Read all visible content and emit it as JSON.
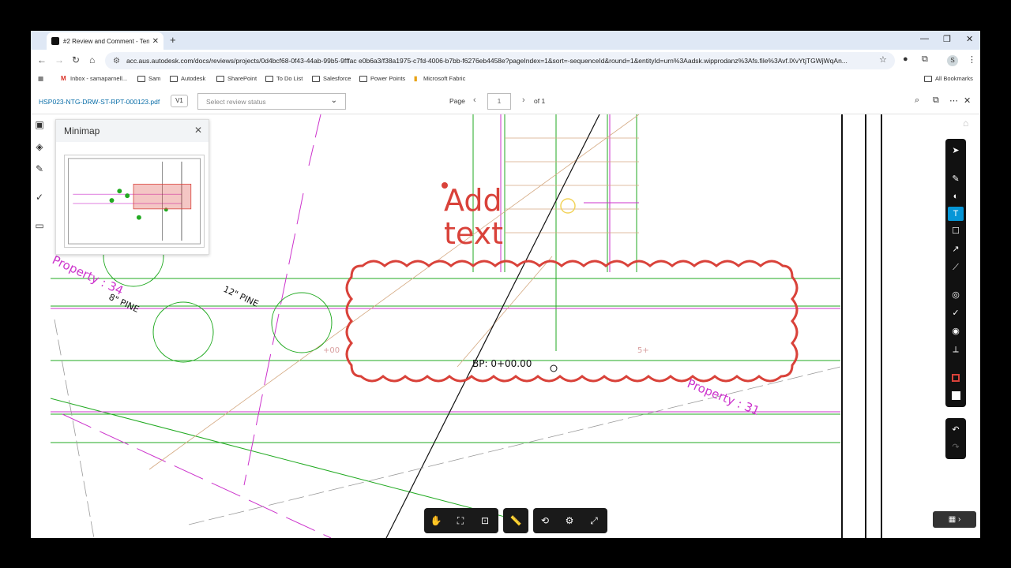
{
  "browser": {
    "tab_title": "#2 Review and Comment - Terr",
    "tab_close": "✕",
    "new_tab": "+",
    "url": "acc.aus.autodesk.com/docs/reviews/projects/0d4bcf68-0f43-44ab-99b5-9fffac e0b6a3/f38a1975-c7fd-4006-b7bb-f6276eb4458e?pageIndex=1&sort=-sequenceId&round=1&entityId=urn%3Aadsk.wipprodanz%3Afs.file%3Avf.lXvYtjTGWjWqAn...",
    "profile_initial": "S",
    "window_controls": {
      "minimize": "—",
      "restore": "❐",
      "close": "✕"
    }
  },
  "bookmarks": {
    "items": [
      {
        "label": "Inbox - samaparnell..."
      },
      {
        "label": "Sam"
      },
      {
        "label": "Autodesk"
      },
      {
        "label": "SharePoint"
      },
      {
        "label": "To Do List"
      },
      {
        "label": "Salesforce"
      },
      {
        "label": "Power Points"
      },
      {
        "label": "Microsoft Fabric"
      }
    ],
    "all_bookmarks": "All Bookmarks"
  },
  "viewer": {
    "filename": "HSP023-NTG-DRW-ST-RPT-000123.pdf",
    "version": "V1",
    "status_placeholder": "Select review status",
    "page_label": "Page",
    "page_value": "1",
    "page_of": "of 1"
  },
  "minimap": {
    "title": "Minimap"
  },
  "drawing": {
    "markup_text_line1": "Add",
    "markup_text_line2": "text",
    "bp_label": "BP:  0+00.00",
    "property_left": "Property : 34",
    "property_right": "Property : 31",
    "pine_8": "8\" PINE",
    "pine_12": "12\" PINE",
    "elev_label": "+00",
    "elev_label2": "5+"
  },
  "colors": {
    "markup_red": "#d9423a",
    "linework_green": "#22aa22",
    "linework_magenta": "#cc33cc",
    "accent_blue": "#0696d7"
  }
}
